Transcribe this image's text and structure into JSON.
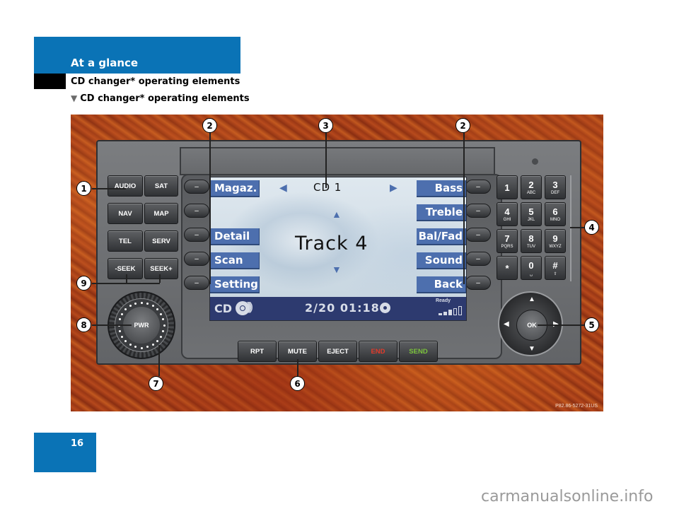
{
  "header": {
    "section": "At a glance",
    "subtitle": "CD changer* operating elements",
    "sub_subtitle_marker": "▼",
    "sub_subtitle": "CD changer* operating elements"
  },
  "colors": {
    "brand_blue": "#0a73b6",
    "softkey_blue": "#4d6fae",
    "status_bar": "#2d3a6f",
    "end_red": "#e23a2a",
    "send_green": "#7cc43c"
  },
  "left_buttons": [
    [
      "AUDIO",
      "SAT"
    ],
    [
      "NAV",
      "MAP"
    ],
    [
      "TEL",
      "SERV"
    ],
    [
      "-SEEK",
      "SEEK+"
    ]
  ],
  "keypad": [
    [
      {
        "d": "1",
        "l": ""
      },
      {
        "d": "2",
        "l": "ABC"
      },
      {
        "d": "3",
        "l": "DEF"
      }
    ],
    [
      {
        "d": "4",
        "l": "GHI"
      },
      {
        "d": "5",
        "l": "JKL"
      },
      {
        "d": "6",
        "l": "MNO"
      }
    ],
    [
      {
        "d": "7",
        "l": "PQRS"
      },
      {
        "d": "8",
        "l": "TUV"
      },
      {
        "d": "9",
        "l": "WXYZ"
      }
    ],
    [
      {
        "d": "*",
        "l": ""
      },
      {
        "d": "0",
        "l": "␣"
      },
      {
        "d": "#",
        "l": "⇧"
      }
    ]
  ],
  "bottom_buttons": [
    "RPT",
    "MUTE",
    "EJECT",
    "END",
    "SEND"
  ],
  "screen": {
    "left_softkeys": [
      "Magaz.",
      "",
      "Detail",
      "Scan",
      "Setting"
    ],
    "right_softkeys": [
      "Bass",
      "Treble",
      "Bal/Fad",
      "Sound",
      "Back"
    ],
    "source": "CD 1",
    "arrow_left": "◀",
    "arrow_right": "▶",
    "arrow_up": "▲",
    "arrow_down": "▼",
    "track": "Track 4",
    "status": {
      "mode": "CD",
      "track_time": "2/20  01:18",
      "ready": "Ready",
      "signal_bars_filled": 3,
      "signal_bars_total": 5
    }
  },
  "softkey_pill_label": "–",
  "power_knob_label": "PWR",
  "ok_label": "OK",
  "callouts": [
    "1",
    "2",
    "3",
    "2",
    "4",
    "5",
    "6",
    "7",
    "8",
    "9"
  ],
  "figure_code": "P82.86-5272-31US",
  "page_number": "16",
  "watermark": "carmanualsonline.info"
}
